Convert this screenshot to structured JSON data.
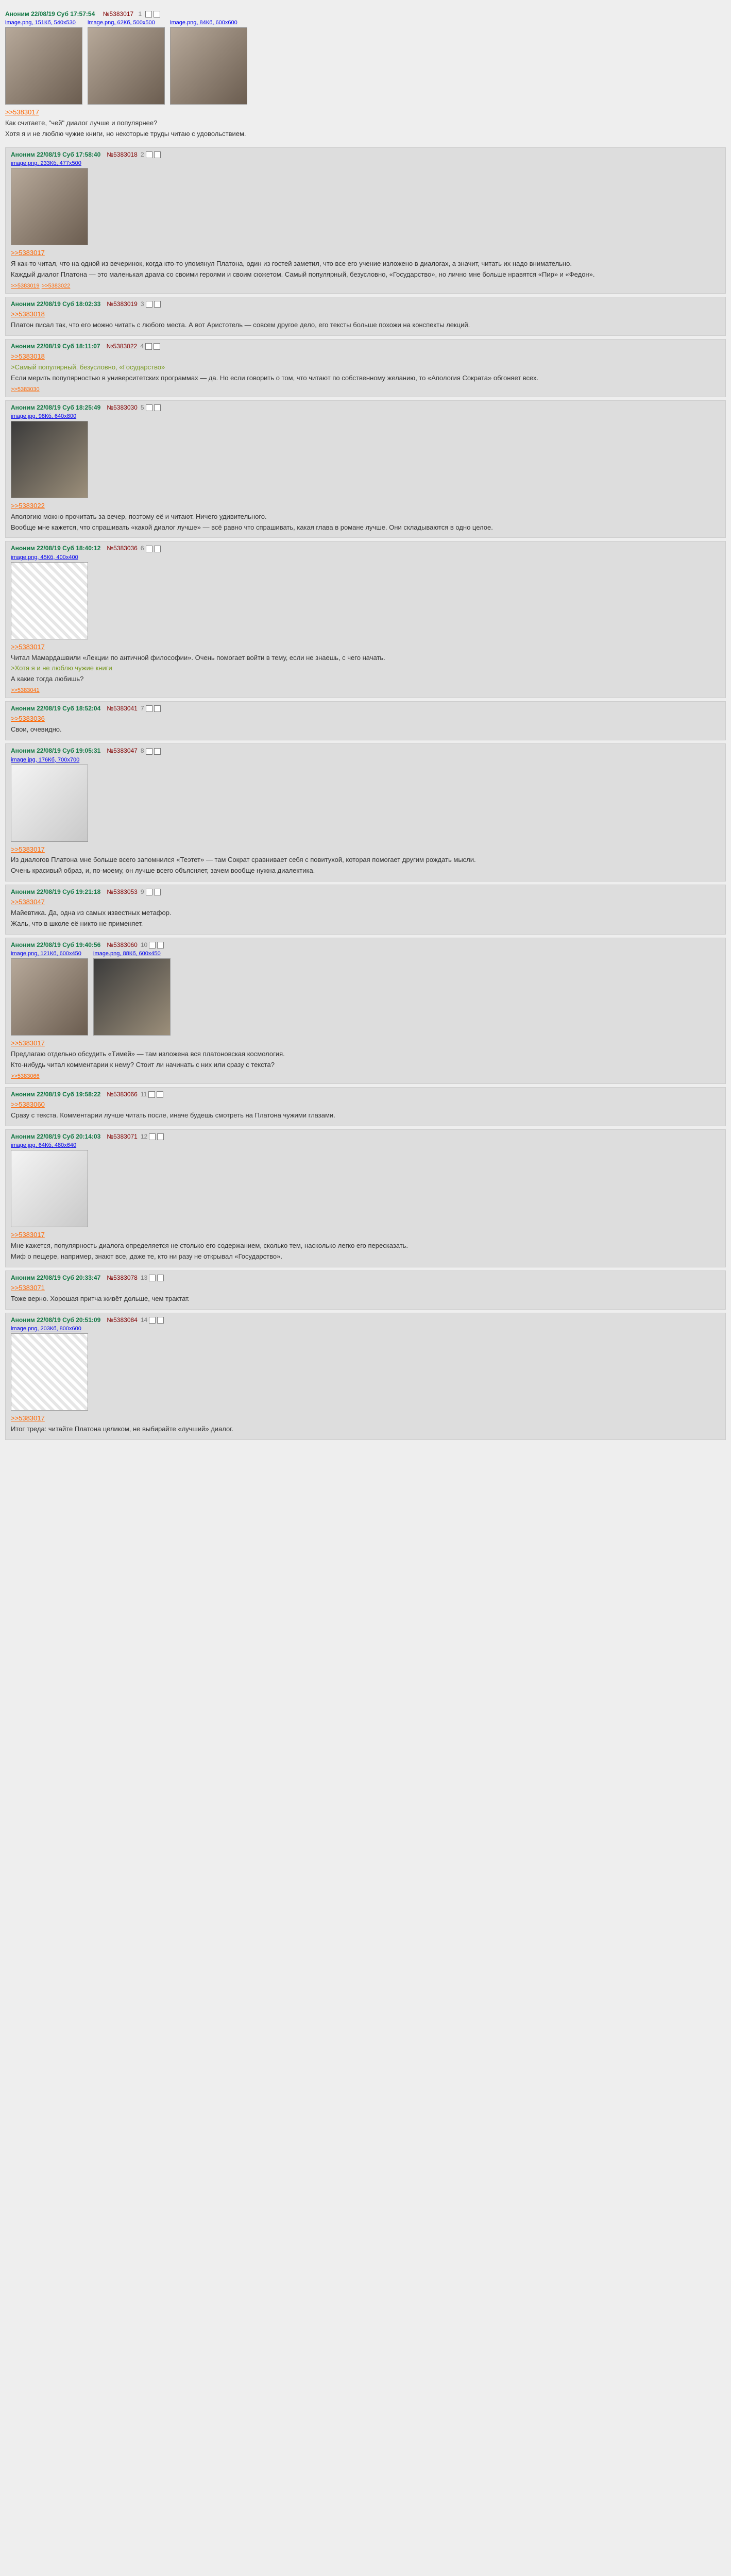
{
  "op": {
    "date": "Аноним 22/08/19 Суб 17:57:54",
    "post_no": "№5383017",
    "num": "1",
    "files": [
      {
        "meta": "image.png, 151Кб, 540x530"
      },
      {
        "meta": "image.png, 62Кб, 500x500"
      },
      {
        "meta": "image.png, 84Кб, 600x600"
      }
    ],
    "lines": [
      ">>5383017",
      "Как считаете, \"чей\" диалог лучше и популярнее?",
      "Хотя я и не люблю чужие книги, но некоторые труды читаю с удовольствием."
    ]
  },
  "posts": [
    {
      "date": "Аноним 22/08/19 Суб 17:58:40",
      "post_no": "№5383018",
      "num": "2",
      "files": [
        {
          "meta": "image.png, 233Кб, 477x500",
          "style": ""
        }
      ],
      "lines": [
        ">>5383017",
        "Я как-то читал, что на одной из вечеринок, когда кто-то упомянул Платона, один из гостей заметил, что все его учение изложено в диалогах, а значит, читать их надо внимательно.",
        "Каждый диалог Платона — это маленькая драма со своими героями и своим сюжетом. Самый популярный, безусловно, «Государство», но лично мне больше нравятся «Пир» и «Федон»."
      ],
      "replies": ">>5383019 >>5383022"
    },
    {
      "date": "Аноним 22/08/19 Суб 18:02:33",
      "post_no": "№5383019",
      "num": "3",
      "files": [],
      "lines": [
        ">>5383018",
        "Платон писал так, что его можно читать с любого места. А вот Аристотель — совсем другое дело, его тексты больше похожи на конспекты лекций."
      ],
      "replies": ""
    },
    {
      "date": "Аноним 22/08/19 Суб 18:11:07",
      "post_no": "№5383022",
      "num": "4",
      "files": [],
      "lines": [
        ">>5383018",
        ">Самый популярный, безусловно, «Государство»",
        "Если мерить популярностью в университетских программах — да. Но если говорить о том, что читают по собственному желанию, то «Апология Сократа» обгоняет всех."
      ],
      "replies": ">>5383030"
    },
    {
      "date": "Аноним 22/08/19 Суб 18:25:49",
      "post_no": "№5383030",
      "num": "5",
      "files": [
        {
          "meta": "image.jpg, 98Кб, 640x800",
          "style": "dark"
        }
      ],
      "lines": [
        ">>5383022",
        "Апологию можно прочитать за вечер, поэтому её и читают. Ничего удивительного.",
        "Вообще мне кажется, что спрашивать «какой диалог лучше» — всё равно что спрашивать, какая глава в романе лучше. Они складываются в одно целое."
      ],
      "replies": ""
    },
    {
      "date": "Аноним 22/08/19 Суб 18:40:12",
      "post_no": "№5383036",
      "num": "6",
      "files": [
        {
          "meta": "image.png, 45Кб, 400x400",
          "style": "sketch"
        }
      ],
      "lines": [
        ">>5383017",
        "Читал Мамардашвили «Лекции по античной философии». Очень помогает войти в тему, если не знаешь, с чего начать.",
        ">Хотя я и не люблю чужие книги",
        "А какие тогда любишь?"
      ],
      "replies": ">>5383041"
    },
    {
      "date": "Аноним 22/08/19 Суб 18:52:04",
      "post_no": "№5383041",
      "num": "7",
      "files": [],
      "lines": [
        ">>5383036",
        "Свои, очевидно."
      ],
      "replies": ""
    },
    {
      "date": "Аноним 22/08/19 Суб 19:05:31",
      "post_no": "№5383047",
      "num": "8",
      "files": [
        {
          "meta": "image.jpg, 176Кб, 700x700",
          "style": "light"
        }
      ],
      "lines": [
        ">>5383017",
        "Из диалогов Платона мне больше всего запомнился «Теэтет» — там Сократ сравнивает себя с повитухой, которая помогает другим рождать мысли.",
        "Очень красивый образ, и, по-моему, он лучше всего объясняет, зачем вообще нужна диалектика."
      ],
      "replies": ""
    },
    {
      "date": "Аноним 22/08/19 Суб 19:21:18",
      "post_no": "№5383053",
      "num": "9",
      "files": [],
      "lines": [
        ">>5383047",
        "Майевтика. Да, одна из самых известных метафор.",
        "Жаль, что в школе её никто не применяет."
      ],
      "replies": ""
    },
    {
      "date": "Аноним 22/08/19 Суб 19:40:56",
      "post_no": "№5383060",
      "num": "10",
      "files": [
        {
          "meta": "image.png, 121Кб, 600x450",
          "style": ""
        },
        {
          "meta": "image.png, 88Кб, 600x450",
          "style": "dark"
        }
      ],
      "lines": [
        ">>5383017",
        "Предлагаю отдельно обсудить «Тимей» — там изложена вся платоновская космология.",
        "Кто-нибудь читал комментарии к нему? Стоит ли начинать с них или сразу с текста?"
      ],
      "replies": ">>5383066"
    },
    {
      "date": "Аноним 22/08/19 Суб 19:58:22",
      "post_no": "№5383066",
      "num": "11",
      "files": [],
      "lines": [
        ">>5383060",
        "Сразу с текста. Комментарии лучше читать после, иначе будешь смотреть на Платона чужими глазами."
      ],
      "replies": ""
    },
    {
      "date": "Аноним 22/08/19 Суб 20:14:03",
      "post_no": "№5383071",
      "num": "12",
      "files": [
        {
          "meta": "image.jpg, 64Кб, 480x640",
          "style": "light"
        }
      ],
      "lines": [
        ">>5383017",
        "Мне кажется, популярность диалога определяется не столько его содержанием, сколько тем, насколько легко его пересказать.",
        "Миф о пещере, например, знают все, даже те, кто ни разу не открывал «Государство»."
      ],
      "replies": ""
    },
    {
      "date": "Аноним 22/08/19 Суб 20:33:47",
      "post_no": "№5383078",
      "num": "13",
      "files": [],
      "lines": [
        ">>5383071",
        "Тоже верно. Хорошая притча живёт дольше, чем трактат."
      ],
      "replies": ""
    },
    {
      "date": "Аноним 22/08/19 Суб 20:51:09",
      "post_no": "№5383084",
      "num": "14",
      "files": [
        {
          "meta": "image.png, 203Кб, 800x600",
          "style": "sketch"
        }
      ],
      "lines": [
        ">>5383017",
        "Итог треда: читайте Платона целиком, не выбирайте «лучший» диалог."
      ],
      "replies": ""
    }
  ]
}
